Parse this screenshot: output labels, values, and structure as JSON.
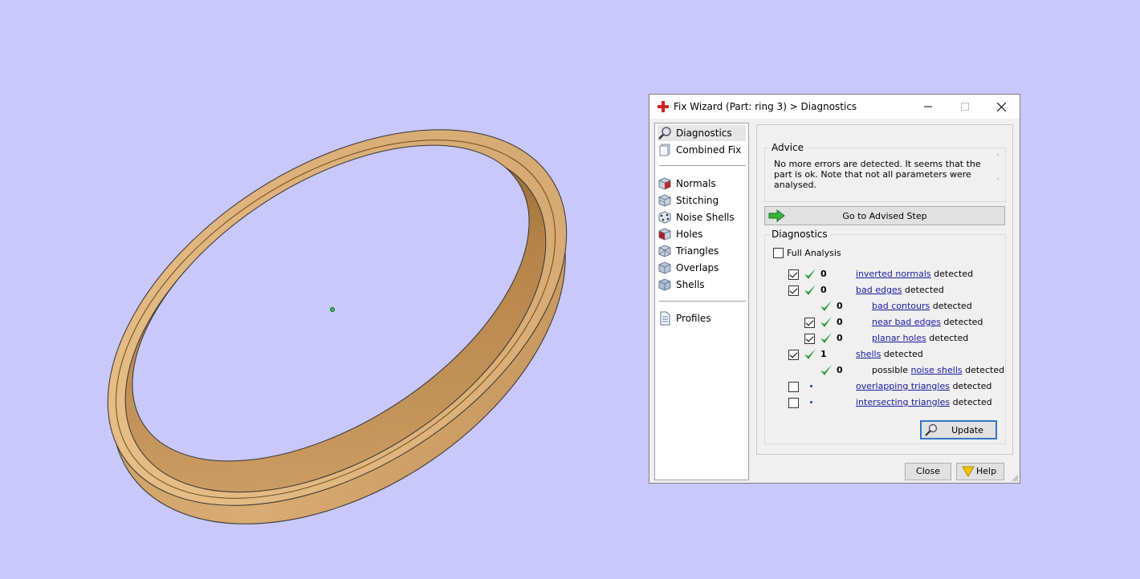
{
  "colors": {
    "viewport_background": "#c8c8fa",
    "ring": "#c49a63",
    "ring_shadow": "#8a6330",
    "ok_check": "#2e9a3a",
    "link": "#1a1aa6"
  },
  "viewport": {
    "object": "ring 3"
  },
  "dialog": {
    "title": "Fix Wizard (Part: ring 3) > Diagnostics",
    "window_controls": {
      "minimize": "—",
      "maximize": "☐",
      "close": "✕"
    },
    "nav": {
      "group1": [
        {
          "label": "Diagnostics",
          "icon": "magnifier-icon",
          "selected": true
        },
        {
          "label": "Combined Fix",
          "icon": "combined-fix-icon"
        }
      ],
      "group2": [
        {
          "label": "Normals",
          "icon": "normals-cube-icon"
        },
        {
          "label": "Stitching",
          "icon": "stitching-cube-icon"
        },
        {
          "label": "Noise Shells",
          "icon": "noise-shells-icon"
        },
        {
          "label": "Holes",
          "icon": "holes-cube-icon"
        },
        {
          "label": "Triangles",
          "icon": "triangles-cube-icon"
        },
        {
          "label": "Overlaps",
          "icon": "overlaps-cube-icon"
        },
        {
          "label": "Shells",
          "icon": "shells-cube-icon"
        }
      ],
      "group3": [
        {
          "label": "Profiles",
          "icon": "document-icon"
        }
      ]
    },
    "advice": {
      "title": "Advice",
      "text": "No more errors are detected. It seems that the part is ok. Note that not all parameters were analysed.",
      "scroll_up": "˄",
      "scroll_down": "˅"
    },
    "advised_step_button": "Go to Advised Step",
    "diagnostics": {
      "title": "Diagnostics",
      "full_analysis": {
        "label": "Full Analysis",
        "checked": false
      },
      "rows": [
        {
          "checked": true,
          "status": "ok",
          "count": "0",
          "prefix": "",
          "link": "inverted normals",
          "suffix": " detected",
          "level": 0
        },
        {
          "checked": true,
          "status": "ok",
          "count": "0",
          "prefix": "",
          "link": "bad edges",
          "suffix": " detected",
          "level": 0
        },
        {
          "checked": null,
          "status": "ok",
          "count": "0",
          "prefix": "",
          "link": "bad contours",
          "suffix": " detected",
          "level": 1
        },
        {
          "checked": true,
          "status": "ok",
          "count": "0",
          "prefix": "",
          "link": "near bad edges",
          "suffix": " detected",
          "level": 1
        },
        {
          "checked": true,
          "status": "ok",
          "count": "0",
          "prefix": "",
          "link": "planar holes",
          "suffix": " detected",
          "level": 1
        },
        {
          "checked": true,
          "status": "ok",
          "count": "1",
          "prefix": "",
          "link": "shells",
          "suffix": " detected",
          "level": 0
        },
        {
          "checked": null,
          "status": "ok",
          "count": "0",
          "prefix": "possible ",
          "link": "noise shells",
          "suffix": " detected",
          "level": 1
        },
        {
          "checked": false,
          "status": "none",
          "count": "",
          "prefix": "",
          "link": "overlapping triangles",
          "suffix": " detected",
          "level": 0
        },
        {
          "checked": false,
          "status": "none",
          "count": "",
          "prefix": "",
          "link": "intersecting triangles",
          "suffix": " detected",
          "level": 0
        }
      ]
    },
    "update_button": "Update",
    "close_button": "Close",
    "help_button": "Help"
  }
}
